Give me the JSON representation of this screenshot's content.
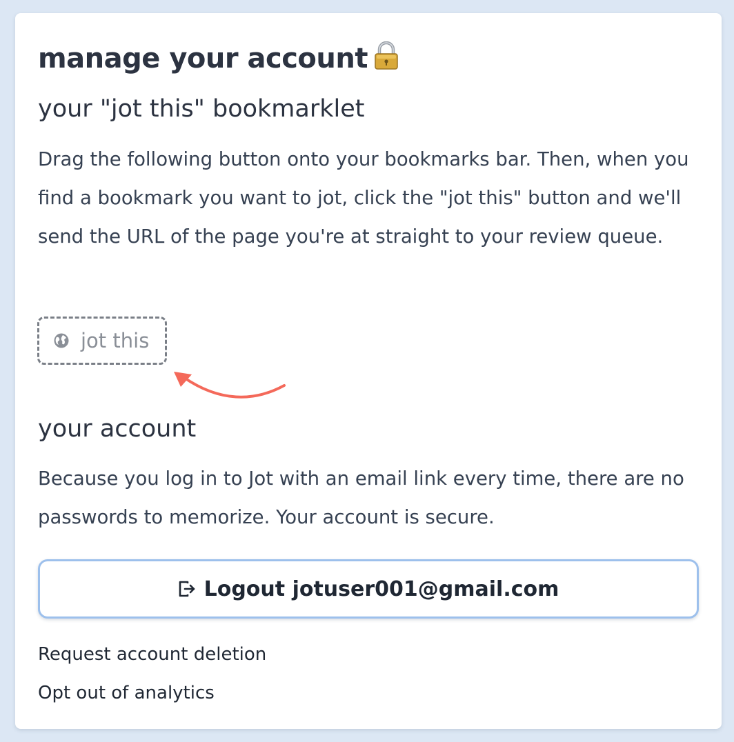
{
  "page": {
    "title": "manage your account",
    "title_icon": "lock-icon"
  },
  "bookmarklet_section": {
    "heading": "your \"jot this\" bookmarklet",
    "description": "Drag the following button onto your bookmarks bar. Then, when you find a bookmark you want to jot, click the \"jot this\" button and we'll send the URL of the page you're at straight to your review queue.",
    "button_label": "jot this",
    "button_icon": "globe-icon",
    "arrow_color": "#f4695a"
  },
  "account_section": {
    "heading": "your account",
    "description": "Because you log in to Jot with an email link every time, there are no passwords to memorize. Your account is secure.",
    "logout_label": "Logout jotuser001@gmail.com",
    "logout_icon": "logout-icon",
    "logout_border_color": "#9dc0ec"
  },
  "links": {
    "delete_label": "Request account deletion",
    "analytics_label": "Opt out of analytics"
  },
  "colors": {
    "background": "#dce7f4",
    "card": "#ffffff",
    "text": "#2f3a4a"
  }
}
